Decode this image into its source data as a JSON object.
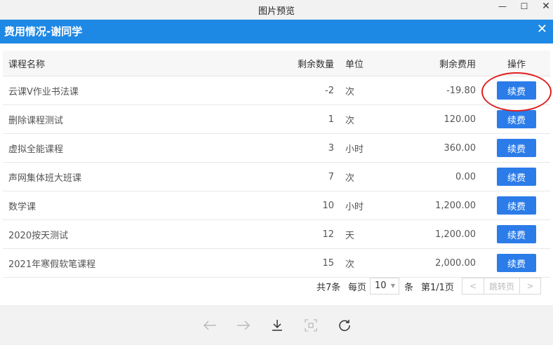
{
  "window": {
    "title": "图片预览",
    "minimize": "—",
    "maximize": "☐",
    "close": "✕"
  },
  "dialog": {
    "title": "费用情况-谢同学",
    "close": "✕"
  },
  "table": {
    "headers": {
      "name": "课程名称",
      "qty": "剩余数量",
      "unit": "单位",
      "fee": "剩余费用",
      "op": "操作"
    },
    "rows": [
      {
        "name": "云课V作业书法课",
        "qty": "-2",
        "unit": "次",
        "fee": "-19.80",
        "op": "续费"
      },
      {
        "name": "删除课程测试",
        "qty": "1",
        "unit": "次",
        "fee": "120.00",
        "op": "续费"
      },
      {
        "name": "虚拟全能课程",
        "qty": "3",
        "unit": "小时",
        "fee": "360.00",
        "op": "续费"
      },
      {
        "name": "声网集体班大班课",
        "qty": "7",
        "unit": "次",
        "fee": "0.00",
        "op": "续费"
      },
      {
        "name": "数学课",
        "qty": "10",
        "unit": "小时",
        "fee": "1,200.00",
        "op": "续费"
      },
      {
        "name": "2020按天测试",
        "qty": "12",
        "unit": "天",
        "fee": "1,200.00",
        "op": "续费"
      },
      {
        "name": "2021年寒假软笔课程",
        "qty": "15",
        "unit": "次",
        "fee": "2,000.00",
        "op": "续费"
      }
    ]
  },
  "pager": {
    "total": "共7条",
    "per_page_label": "每页",
    "per_page_value": "10",
    "per_page_unit": "条",
    "page_info": "第1/1页",
    "prev": "<",
    "jump": "跳转页",
    "next": ">"
  },
  "colors": {
    "header_bg": "#1e88e5",
    "button_bg": "#2b7ce9",
    "highlight_circle": "#e02020"
  }
}
